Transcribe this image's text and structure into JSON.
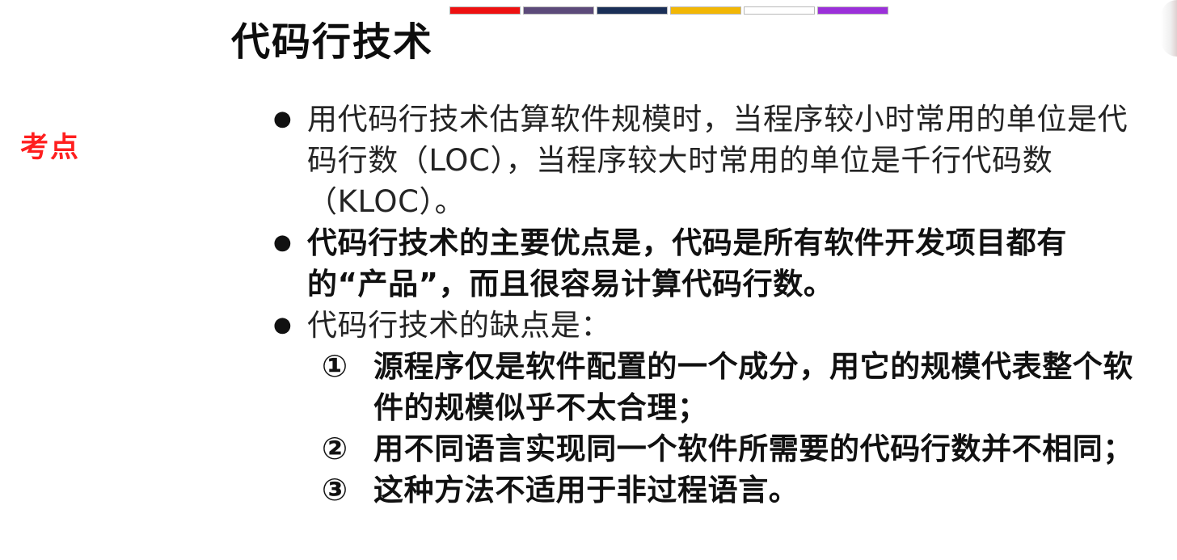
{
  "accent_colors": [
    "#ee1111",
    "#5c4a7a",
    "#1a2f57",
    "#f2b705",
    "#ffffff",
    "#9b30d9"
  ],
  "title": "代码行技术",
  "side_label": "考点",
  "colors": {
    "title_text": "#0d0d0d",
    "side_label": "#ff1f1f",
    "body_text": "#242424"
  },
  "bullets": [
    {
      "marker": "●",
      "text": "用代码行技术估算软件规模时，当程序较小时常用的单位是代码行数（LOC），当程序较大时常用的单位是千行代码数（KLOC）。",
      "bold": false
    },
    {
      "marker": "●",
      "text": "代码行技术的主要优点是，代码是所有软件开发项目都有的“产品”，而且很容易计算代码行数。",
      "bold": true
    },
    {
      "marker": "●",
      "text": "代码行技术的缺点是：",
      "bold": false
    }
  ],
  "disadvantages": [
    {
      "marker": "①",
      "text": "源程序仅是软件配置的一个成分，用它的规模代表整个软件的规模似乎不太合理；"
    },
    {
      "marker": "②",
      "text": "用不同语言实现同一个软件所需要的代码行数并不相同；"
    },
    {
      "marker": "③",
      "text": "这种方法不适用于非过程语言。"
    }
  ]
}
